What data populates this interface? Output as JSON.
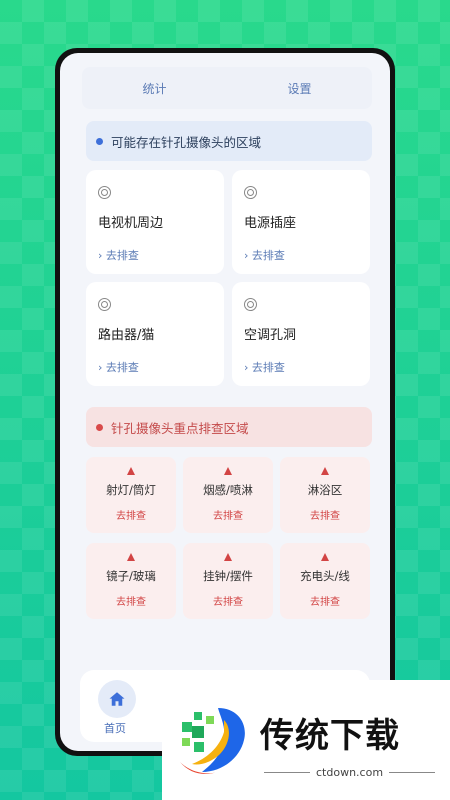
{
  "tabs": [
    {
      "label": "统计"
    },
    {
      "label": "设置"
    }
  ],
  "section_possible": {
    "title": "可能存在针孔摄像头的区域",
    "cards": [
      {
        "title": "电视机周边",
        "link": "› 去排查"
      },
      {
        "title": "电源插座",
        "link": "› 去排查"
      },
      {
        "title": "路由器/猫",
        "link": "› 去排查"
      },
      {
        "title": "空调孔洞",
        "link": "› 去排查"
      }
    ]
  },
  "section_key": {
    "title": "针孔摄像头重点排查区域",
    "cards": [
      {
        "title": "射灯/筒灯",
        "link": "去排查"
      },
      {
        "title": "烟感/喷淋",
        "link": "去排查"
      },
      {
        "title": "淋浴区",
        "link": "去排查"
      },
      {
        "title": "镜子/玻璃",
        "link": "去排查"
      },
      {
        "title": "挂钟/摆件",
        "link": "去排查"
      },
      {
        "title": "充电头/线",
        "link": "去排查"
      }
    ]
  },
  "bottom_nav": {
    "home_label": "首页"
  },
  "watermark": {
    "brand": "传统下载",
    "url": "ctdown.com"
  },
  "colors": {
    "accent_blue": "#3d6fd9",
    "accent_red": "#d24444",
    "background_green": "#1fcf85"
  }
}
